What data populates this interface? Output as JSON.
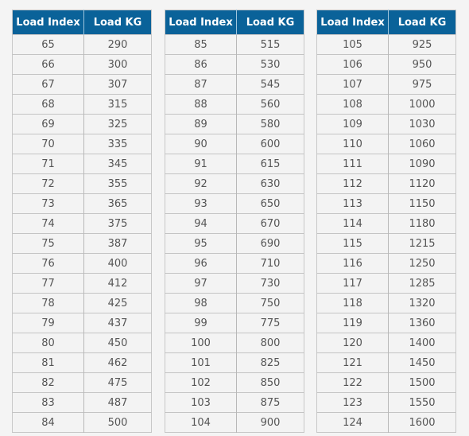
{
  "headers": [
    "Load Index",
    "Load KG"
  ],
  "tables": [
    {
      "rows": [
        [
          "65",
          "290"
        ],
        [
          "66",
          "300"
        ],
        [
          "67",
          "307"
        ],
        [
          "68",
          "315"
        ],
        [
          "69",
          "325"
        ],
        [
          "70",
          "335"
        ],
        [
          "71",
          "345"
        ],
        [
          "72",
          "355"
        ],
        [
          "73",
          "365"
        ],
        [
          "74",
          "375"
        ],
        [
          "75",
          "387"
        ],
        [
          "76",
          "400"
        ],
        [
          "77",
          "412"
        ],
        [
          "78",
          "425"
        ],
        [
          "79",
          "437"
        ],
        [
          "80",
          "450"
        ],
        [
          "81",
          "462"
        ],
        [
          "82",
          "475"
        ],
        [
          "83",
          "487"
        ],
        [
          "84",
          "500"
        ]
      ]
    },
    {
      "rows": [
        [
          "85",
          "515"
        ],
        [
          "86",
          "530"
        ],
        [
          "87",
          "545"
        ],
        [
          "88",
          "560"
        ],
        [
          "89",
          "580"
        ],
        [
          "90",
          "600"
        ],
        [
          "91",
          "615"
        ],
        [
          "92",
          "630"
        ],
        [
          "93",
          "650"
        ],
        [
          "94",
          "670"
        ],
        [
          "95",
          "690"
        ],
        [
          "96",
          "710"
        ],
        [
          "97",
          "730"
        ],
        [
          "98",
          "750"
        ],
        [
          "99",
          "775"
        ],
        [
          "100",
          "800"
        ],
        [
          "101",
          "825"
        ],
        [
          "102",
          "850"
        ],
        [
          "103",
          "875"
        ],
        [
          "104",
          "900"
        ]
      ]
    },
    {
      "rows": [
        [
          "105",
          "925"
        ],
        [
          "106",
          "950"
        ],
        [
          "107",
          "975"
        ],
        [
          "108",
          "1000"
        ],
        [
          "109",
          "1030"
        ],
        [
          "110",
          "1060"
        ],
        [
          "111",
          "1090"
        ],
        [
          "112",
          "1120"
        ],
        [
          "113",
          "1150"
        ],
        [
          "114",
          "1180"
        ],
        [
          "115",
          "1215"
        ],
        [
          "116",
          "1250"
        ],
        [
          "117",
          "1285"
        ],
        [
          "118",
          "1320"
        ],
        [
          "119",
          "1360"
        ],
        [
          "120",
          "1400"
        ],
        [
          "121",
          "1450"
        ],
        [
          "122",
          "1500"
        ],
        [
          "123",
          "1550"
        ],
        [
          "124",
          "1600"
        ]
      ]
    }
  ],
  "colors": {
    "header_bg": "#0a6299",
    "header_text": "#ffffff",
    "cell_text": "#555555"
  }
}
